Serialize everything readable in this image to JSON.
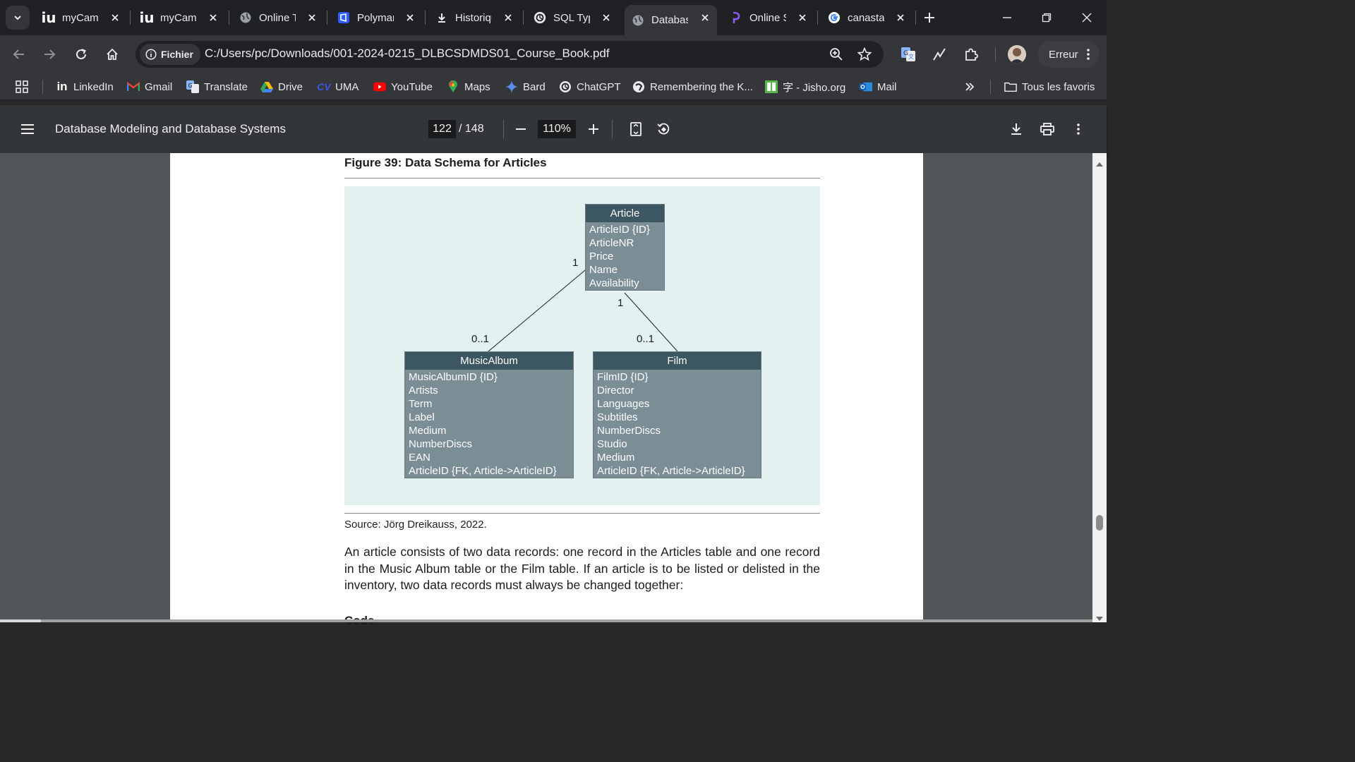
{
  "tabs": [
    {
      "title": "myCampus",
      "icon": "iu-icon"
    },
    {
      "title": "myCampus",
      "icon": "iu-icon"
    },
    {
      "title": "Online Training",
      "icon": "globe-icon"
    },
    {
      "title": "Polymarket",
      "icon": "polymarket-icon"
    },
    {
      "title": "Historique",
      "icon": "download-icon"
    },
    {
      "title": "SQL Types",
      "icon": "openai-icon"
    },
    {
      "title": "Database",
      "icon": "globe-icon"
    },
    {
      "title": "Online SQL",
      "icon": "perplexity-icon"
    },
    {
      "title": "canasta",
      "icon": "google-icon"
    }
  ],
  "omnibox": {
    "chip_label": "Fichier",
    "url": "C:/Users/pc/Downloads/001-2024-0215_DLBCSDMDS01_Course_Book.pdf"
  },
  "profile": {
    "error_label": "Erreur"
  },
  "bookmarks": [
    {
      "label": "LinkedIn",
      "icon": "linkedin-icon"
    },
    {
      "label": "Gmail",
      "icon": "gmail-icon"
    },
    {
      "label": "Translate",
      "icon": "translate-icon"
    },
    {
      "label": "Drive",
      "icon": "drive-icon"
    },
    {
      "label": "UMA",
      "icon": "uma-icon"
    },
    {
      "label": "YouTube",
      "icon": "youtube-icon"
    },
    {
      "label": "Maps",
      "icon": "maps-icon"
    },
    {
      "label": "Bard",
      "icon": "bard-icon"
    },
    {
      "label": "ChatGPT",
      "icon": "openai-icon"
    },
    {
      "label": "Remembering the K...",
      "icon": "rtk-icon"
    },
    {
      "label": "字 - Jisho.org",
      "icon": "jisho-icon"
    },
    {
      "label": "Mail",
      "icon": "outlook-icon"
    }
  ],
  "all_bookmarks_label": "Tous les favoris",
  "pdf": {
    "title": "Database Modeling and Database Systems",
    "current_page": "122",
    "total_pages": "/ 148",
    "zoom": "110%"
  },
  "document": {
    "figure_title": "Figure 39: Data Schema for Articles",
    "entities": {
      "article": {
        "name": "Article",
        "attributes": [
          "ArticleID {ID}",
          "ArticleNR",
          "Price",
          "Name",
          "Availability"
        ]
      },
      "music_album": {
        "name": "MusicAlbum",
        "attributes": [
          "MusicAlbumID {ID}",
          "Artists",
          "Term",
          "Label",
          "Medium",
          "NumberDiscs",
          "EAN",
          "ArticleID {FK, Article->ArticleID}"
        ]
      },
      "film": {
        "name": "Film",
        "attributes": [
          "FilmID {ID}",
          "Director",
          "Languages",
          "Subtitles",
          "NumberDiscs",
          "Studio",
          "Medium",
          "ArticleID {FK, Article->ArticleID}"
        ]
      }
    },
    "multiplicities": {
      "article_to_album": "1",
      "article_to_film": "1",
      "album_side": "0..1",
      "film_side": "0..1"
    },
    "source": "Source: Jörg Dreikauss, 2022.",
    "paragraph": "An article consists of two data records: one record in the Articles table and one record in the Music Album table or the Film table. If an article is to be listed or delisted in the inventory, two data records must always be changed together:",
    "next_heading": "Code"
  },
  "colors": {
    "figure_background": "#e3f1f1",
    "entity_header": "#3c5762",
    "entity_body": "#7b8d95"
  }
}
